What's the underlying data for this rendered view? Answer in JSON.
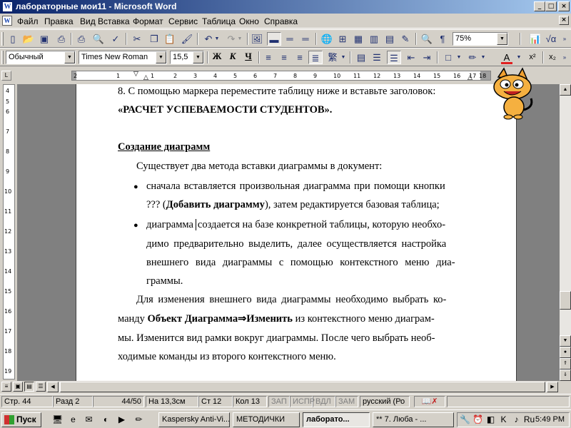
{
  "window": {
    "title": "лабораторные мои11 - Microsoft Word",
    "controls": [
      "_",
      "□",
      "×"
    ]
  },
  "menu": {
    "items": [
      "Файл",
      "Правка",
      "Вид",
      "Вставка",
      "Формат",
      "Сервис",
      "Таблица",
      "Окно",
      "Справка"
    ],
    "doc_close": "×"
  },
  "toolbar_standard": {
    "zoom": "75%"
  },
  "toolbar_formatting": {
    "style": "Обычный",
    "font": "Times New Roman",
    "size": "15,5",
    "bold": "Ж",
    "italic": "К",
    "underline": "Ч"
  },
  "ruler": {
    "labels": [
      "2",
      "1",
      "1",
      "2",
      "3",
      "4",
      "5",
      "6",
      "7",
      "8",
      "9",
      "10",
      "11",
      "12",
      "13",
      "14",
      "15",
      "16",
      "17",
      "18"
    ]
  },
  "vruler": {
    "labels": [
      "4",
      "5",
      "6",
      "7",
      "8",
      "9",
      "10",
      "11",
      "12",
      "13",
      "14",
      "15",
      "16",
      "17",
      "18",
      "19"
    ]
  },
  "document": {
    "l1": "8.  С помощью маркера переместите таблицу ниже и вставьте заголовок:",
    "l2": "«РАСЧЕТ УСПЕВАЕМОСТИ СТУДЕНТОВ».",
    "heading": "Создание диаграмм",
    "intro": "Существует два метода вставки диаграммы в документ:",
    "b1_l1": "сначала вставляется произвольная диаграмма при помощи кнопки",
    "b1_l2_a": "??? (",
    "b1_l2_b": "Добавить диаграмму",
    "b1_l2_c": "), затем редактируется базовая таблица;",
    "b2_l1_a": "диаграмма",
    "b2_l1_b": "создается на базе конкретной таблицы, которую необхо-",
    "b2_l2": "димо предварительно выделить, далее осуществляется настройка",
    "b2_l3": "внешнего вида диаграммы с помощью контекстного меню диа-",
    "b2_l4": "граммы.",
    "p_l1": "Для изменения внешнего вида диаграммы необходимо выбрать ко-",
    "p_l2_a": "манду ",
    "p_l2_b": "Объект Диаграмма",
    "p_l2_arrow": "⇒",
    "p_l2_c": "Изменить",
    "p_l2_d": " из контекстного меню диаграм-",
    "p_l3": "мы. Изменится вид рамки вокруг диаграммы. После чего выбрать необ-",
    "p_l4": "ходимые команды из второго контекстного меню.",
    "bullet_char": "●"
  },
  "statusbar": {
    "page": "Стр.  44",
    "section": "Разд  2",
    "pages": "44/50",
    "at": "На  13,3см",
    "line": "Ст  12",
    "col": "Кол  13",
    "rec": "ЗАП",
    "trk": "ИСПР",
    "ext": "ВДЛ",
    "ovr": "ЗАМ",
    "lang": "русский (Ро"
  },
  "taskbar": {
    "start": "Пуск",
    "tasks": [
      "Kaspersky Anti-Vi...",
      "МЕТОДИЧКИ",
      "лаборато...",
      "** 7. Люба - ..."
    ],
    "clock": "5:49 PM"
  },
  "colors": {
    "title_active": "#0a246a",
    "face": "#d4d0c8",
    "workspace": "#808080",
    "font_color_bar": "#e02020"
  }
}
